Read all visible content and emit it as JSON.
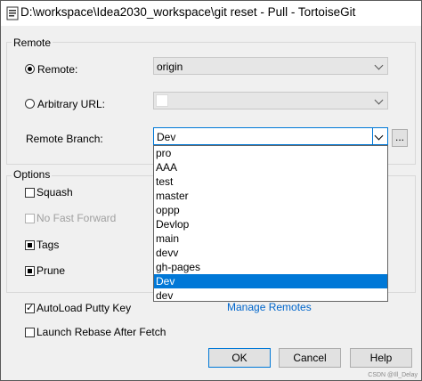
{
  "window": {
    "title": "D:\\workspace\\Idea2030_workspace\\git reset - Pull - TortoiseGit"
  },
  "remote_group": {
    "label": "Remote",
    "remote_radio_label": "Remote:",
    "remote_selected": true,
    "remote_value": "origin",
    "url_radio_label": "Arbitrary URL:",
    "url_value": "",
    "branch_label": "Remote Branch:",
    "branch_value": "Dev",
    "browse_label": "...",
    "dropdown_items": [
      "pro",
      "AAA",
      "test",
      "master",
      "oppp",
      "Devlop",
      "main",
      "devv",
      "gh-pages",
      "Dev",
      "dev"
    ],
    "dropdown_selected": "Dev"
  },
  "options_group": {
    "label": "Options",
    "squash_label": "Squash",
    "squash_checked": false,
    "no_ff_label": "No Fast Forward",
    "no_ff_enabled": false,
    "tags_label": "Tags",
    "tags_state": "indeterminate",
    "prune_label": "Prune",
    "prune_state": "indeterminate"
  },
  "autoload_label": "AutoLoad Putty Key",
  "autoload_checked": true,
  "rebase_label": "Launch Rebase After Fetch",
  "rebase_checked": false,
  "manage_remotes_label": "Manage Remotes",
  "buttons": {
    "ok": "OK",
    "cancel": "Cancel",
    "help": "Help"
  },
  "watermark": "CSDN @Ill_Delay"
}
